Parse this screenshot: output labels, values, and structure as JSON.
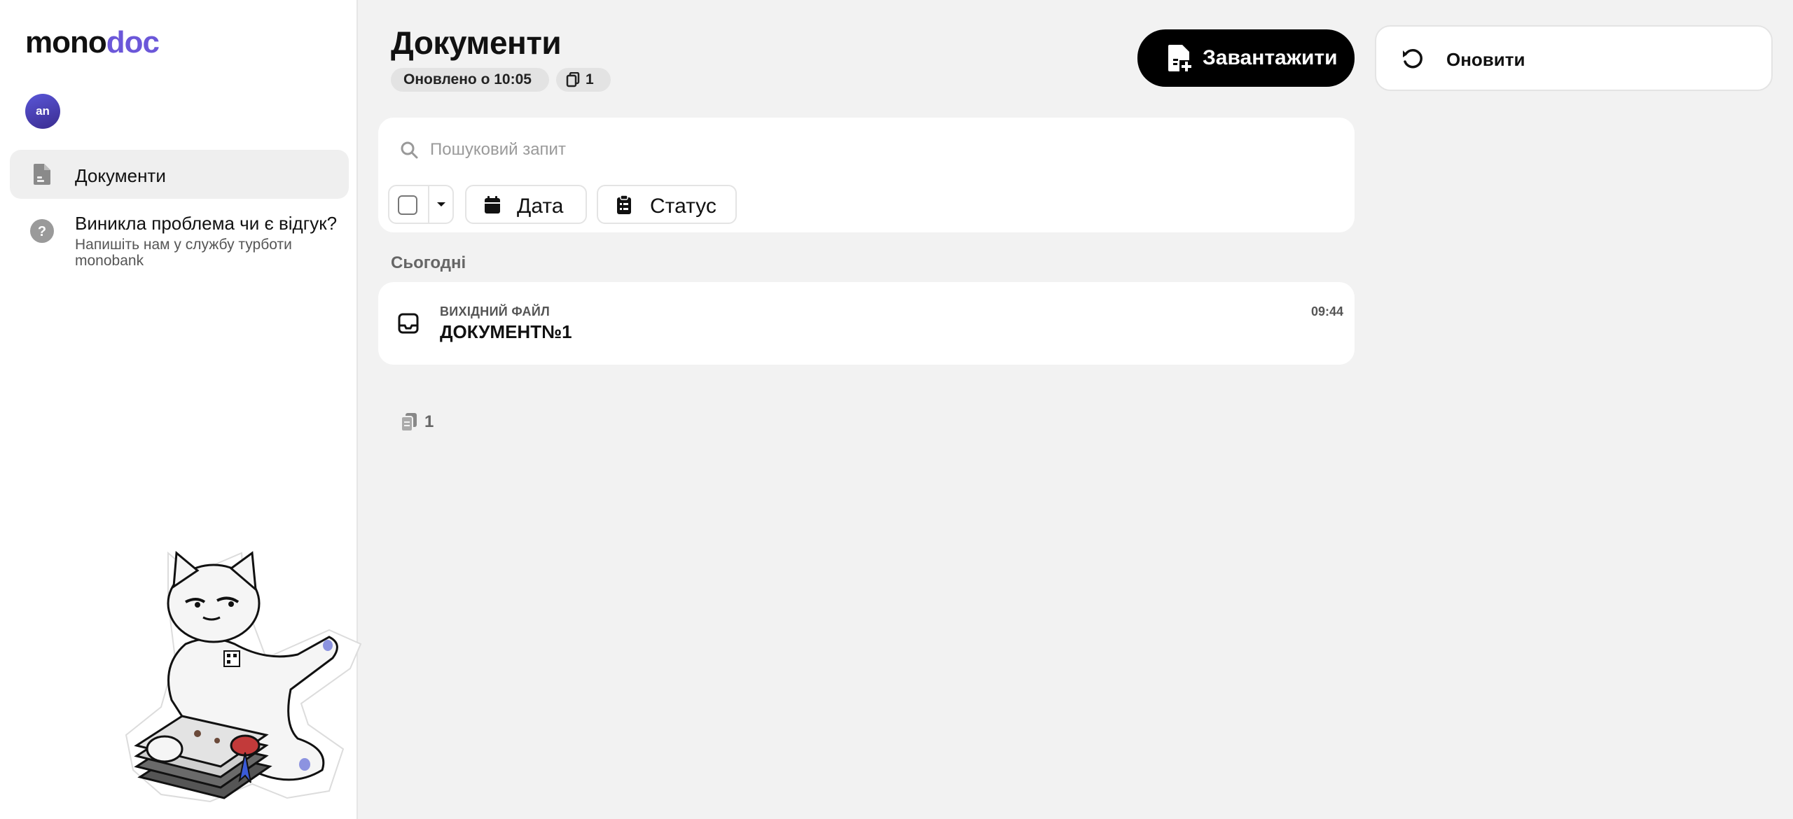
{
  "app": {
    "logo_part1": "mono",
    "logo_part2": "doc",
    "avatar_initials": "an"
  },
  "sidebar": {
    "items": [
      {
        "label": "Документи",
        "icon": "document-icon",
        "active": true
      }
    ],
    "help": {
      "title": "Виникла проблема чи є відгук?",
      "subtitle": "Напишіть нам у службу турботи monobank",
      "icon": "question-icon"
    }
  },
  "header": {
    "title": "Документи",
    "updated": "Оновлено о 10:05",
    "doc_count": "1",
    "upload_label": "Завантажити",
    "refresh_label": "Оновити"
  },
  "search": {
    "placeholder": "Пошуковий запит",
    "value": ""
  },
  "filters": {
    "date_label": "Дата",
    "status_label": "Статус"
  },
  "groups": [
    {
      "title": "Сьогодні",
      "documents": [
        {
          "type": "ВИХІДНИЙ ФАЙЛ",
          "name": "ДОКУМЕНТ№1",
          "time": "09:44",
          "icon": "inbox-icon"
        }
      ]
    }
  ],
  "footer": {
    "total": "1"
  },
  "colors": {
    "accent": "#6b57d9",
    "primary_button": "#000000",
    "background": "#f2f2f2"
  }
}
